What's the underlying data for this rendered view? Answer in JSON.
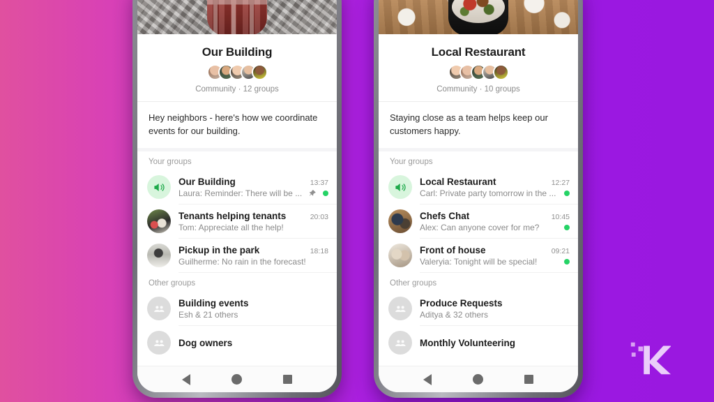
{
  "background": {
    "gradient_from": "#e0509f",
    "gradient_to": "#9a18e0"
  },
  "accent_colors": {
    "unread_dot": "#25d366",
    "announcement_bg": "#d8f5dd",
    "announcement_fg": "#1faa4b"
  },
  "watermark": {
    "name": "k-logo",
    "letter": "K"
  },
  "phones": [
    {
      "id": "left",
      "cover_photo": "aerial-city-buildings",
      "group_avatar": "red-brick-building",
      "header": {
        "title": "Our Building",
        "meta": "Community · 12 groups",
        "members": [
          "member-1",
          "member-2",
          "member-3",
          "member-4",
          "member-5"
        ]
      },
      "description": "Hey neighbors - here's how we coordinate events for our building.",
      "sections": [
        {
          "label": "Your groups",
          "rows": [
            {
              "avatar": "announcement-megaphone",
              "title": "Our Building",
              "subtitle": "Laura: Reminder:  There will be ...",
              "time": "13:37",
              "pinned": true,
              "unread": true
            },
            {
              "avatar": "tenants-photo",
              "title": "Tenants helping tenants",
              "subtitle": "Tom: Appreciate all the help!",
              "time": "20:03",
              "pinned": false,
              "unread": false
            },
            {
              "avatar": "park-photo",
              "title": "Pickup in the park",
              "subtitle": "Guilherme: No rain in the forecast!",
              "time": "18:18",
              "pinned": false,
              "unread": false
            }
          ]
        },
        {
          "label": "Other groups",
          "rows": [
            {
              "avatar": "group-placeholder",
              "title": "Building events",
              "subtitle": "Esh & 21 others",
              "time": "",
              "pinned": false,
              "unread": false
            },
            {
              "avatar": "group-placeholder",
              "title": "Dog owners",
              "subtitle": "",
              "time": "",
              "pinned": false,
              "unread": false
            }
          ]
        }
      ],
      "navbar": {
        "back": "back-button",
        "home": "home-button",
        "recents": "recents-button"
      }
    },
    {
      "id": "right",
      "cover_photo": "restaurant-table",
      "group_avatar": "plated-food",
      "header": {
        "title": "Local Restaurant",
        "meta": "Community · 10 groups",
        "members": [
          "member-1",
          "member-2",
          "member-3",
          "member-4",
          "member-5"
        ]
      },
      "description": "Staying close as a team helps keep our customers happy.",
      "sections": [
        {
          "label": "Your groups",
          "rows": [
            {
              "avatar": "announcement-megaphone",
              "title": "Local Restaurant",
              "subtitle": "Carl: Private party tomorrow in the ...",
              "time": "12:27",
              "pinned": false,
              "unread": true
            },
            {
              "avatar": "chefs-photo",
              "title": "Chefs Chat",
              "subtitle": "Alex: Can anyone cover for me?",
              "time": "10:45",
              "pinned": false,
              "unread": true
            },
            {
              "avatar": "front-of-house-photo",
              "title": "Front of house",
              "subtitle": "Valeryia: Tonight will be special!",
              "time": "09:21",
              "pinned": false,
              "unread": true
            }
          ]
        },
        {
          "label": "Other groups",
          "rows": [
            {
              "avatar": "group-placeholder",
              "title": "Produce Requests",
              "subtitle": "Aditya & 32 others",
              "time": "",
              "pinned": false,
              "unread": false
            },
            {
              "avatar": "group-placeholder",
              "title": "Monthly Volunteering",
              "subtitle": "",
              "time": "",
              "pinned": false,
              "unread": false
            }
          ]
        }
      ],
      "navbar": {
        "back": "back-button",
        "home": "home-button",
        "recents": "recents-button"
      }
    }
  ]
}
